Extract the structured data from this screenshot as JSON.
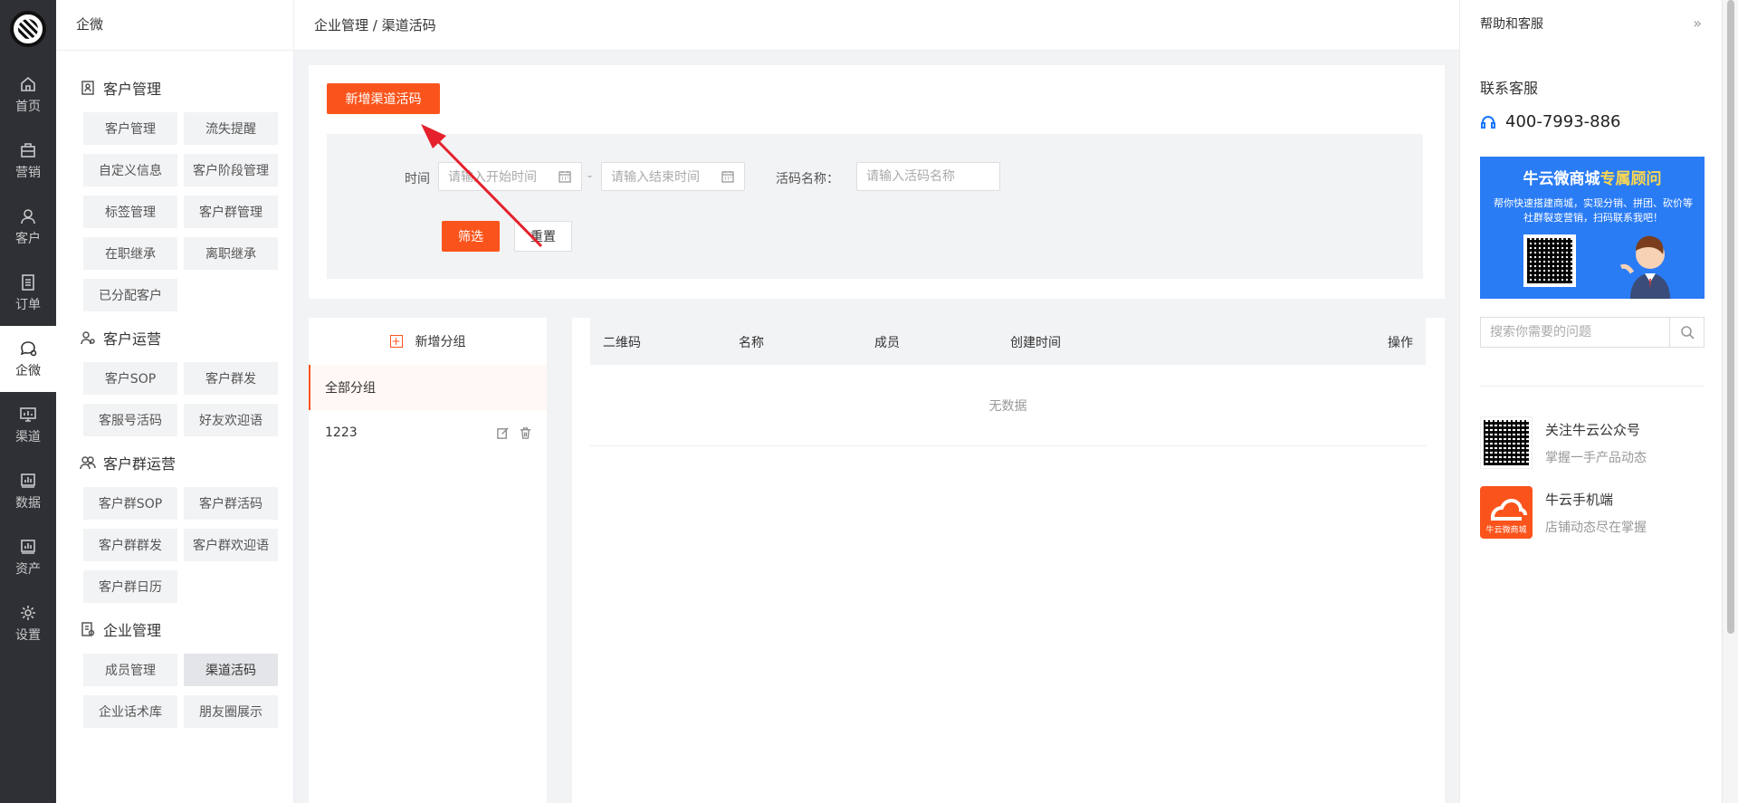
{
  "rail": {
    "items": [
      {
        "label": "首页",
        "icon": "home-icon"
      },
      {
        "label": "营销",
        "icon": "briefcase-icon"
      },
      {
        "label": "客户",
        "icon": "user-icon"
      },
      {
        "label": "订单",
        "icon": "list-icon"
      },
      {
        "label": "企微",
        "icon": "chat-icon",
        "active": true
      },
      {
        "label": "渠道",
        "icon": "monitor-icon"
      },
      {
        "label": "数据",
        "icon": "bar-chart-icon"
      },
      {
        "label": "资产",
        "icon": "bar-chart-icon"
      },
      {
        "label": "设置",
        "icon": "gear-icon"
      }
    ]
  },
  "sidebar": {
    "title": "企微",
    "groups": [
      {
        "title": "客户管理",
        "items": [
          "客户管理",
          "流失提醒",
          "自定义信息",
          "客户阶段管理",
          "标签管理",
          "客户群管理",
          "在职继承",
          "离职继承",
          "已分配客户"
        ]
      },
      {
        "title": "客户运营",
        "items": [
          "客户SOP",
          "客户群发",
          "客服号活码",
          "好友欢迎语"
        ]
      },
      {
        "title": "客户群运营",
        "items": [
          "客户群SOP",
          "客户群活码",
          "客户群群发",
          "客户群欢迎语",
          "客户群日历"
        ]
      },
      {
        "title": "企业管理",
        "items": [
          "成员管理",
          "渠道活码",
          "企业话术库",
          "朋友圈展示"
        ],
        "active_item": "渠道活码"
      }
    ]
  },
  "breadcrumb": "企业管理 / 渠道活码",
  "toolbar": {
    "add_label": "新增渠道活码"
  },
  "filter": {
    "time_label": "时间",
    "start_placeholder": "请输入开始时间",
    "separator": "-",
    "end_placeholder": "请输入结束时间",
    "name_label": "活码名称：",
    "name_placeholder": "请输入活码名称",
    "filter_label": "筛选",
    "reset_label": "重置"
  },
  "groups_panel": {
    "add_label": "新增分组",
    "items": [
      {
        "label": "全部分组",
        "active": true
      },
      {
        "label": "1223",
        "editable": true
      }
    ]
  },
  "table": {
    "columns": [
      "二维码",
      "名称",
      "成员",
      "创建时间",
      "操作"
    ],
    "rows": [],
    "empty_text": "无数据"
  },
  "help": {
    "title": "帮助和客服",
    "contact_title": "联系客服",
    "phone": "400-7993-886",
    "banner_title_a": "牛云微商城",
    "banner_title_b": "专属顾问",
    "banner_sub": "帮你快速搭建商城，实现分销、拼团、砍价等社群裂变营销，扫码联系我吧！",
    "search_placeholder": "搜索你需要的问题",
    "promos": [
      {
        "title": "关注牛云公众号",
        "sub": "掌握一手产品动态",
        "icon": "qr-code-icon"
      },
      {
        "title": "牛云手机端",
        "sub": "店铺动态尽在掌握",
        "icon": "app-logo-icon",
        "badge": "牛云微商城"
      }
    ]
  },
  "colors": {
    "accent": "#fa541c",
    "rail_bg": "#2f3033",
    "banner_bg": "#2a7cf5"
  }
}
